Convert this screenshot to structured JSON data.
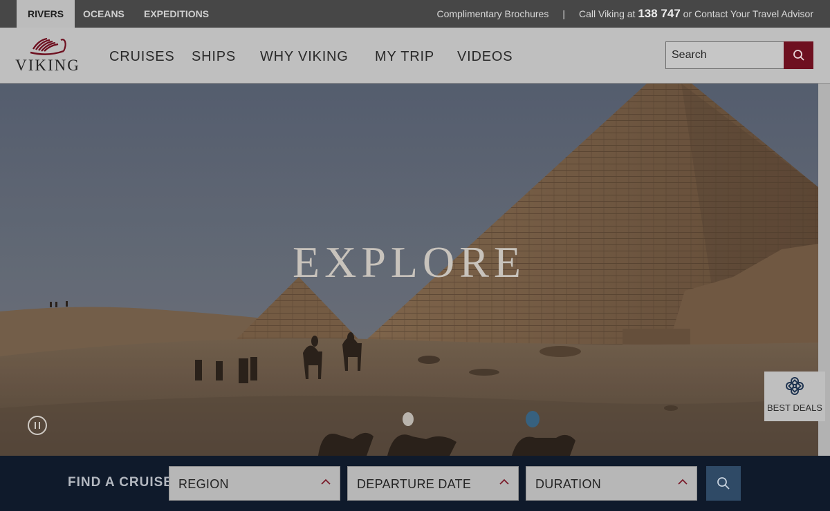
{
  "top_bar": {
    "tabs": [
      {
        "label": "RIVERS",
        "active": true
      },
      {
        "label": "OCEANS",
        "active": false
      },
      {
        "label": "EXPEDITIONS",
        "active": false
      }
    ],
    "brochures_link": "Complimentary Brochures",
    "separator": "|",
    "call_prefix": "Call Viking at",
    "phone": "138 747",
    "contact_link": "or Contact Your Travel Advisor"
  },
  "header": {
    "logo_text": "VIKING",
    "nav": [
      "CRUISES",
      "SHIPS",
      "WHY VIKING",
      "MY TRIP",
      "VIDEOS"
    ],
    "search_placeholder": "Search"
  },
  "hero": {
    "title": "EXPLORE",
    "best_deals_label": "BEST DEALS"
  },
  "finder": {
    "label": "FIND A CRUISE",
    "selects": [
      "REGION",
      "DEPARTURE DATE",
      "DURATION"
    ]
  },
  "icons": {
    "search": "search-icon",
    "pause": "pause-icon",
    "chevron": "chevron-up-icon",
    "best_deals": "knot-icon",
    "logo": "longship-icon"
  },
  "colors": {
    "accent": "#6e1020",
    "finder_bg": "#0f1a2b",
    "finder_button": "#2f4a66",
    "topbar_bg": "#474747",
    "header_bg": "#bfbfbf"
  }
}
